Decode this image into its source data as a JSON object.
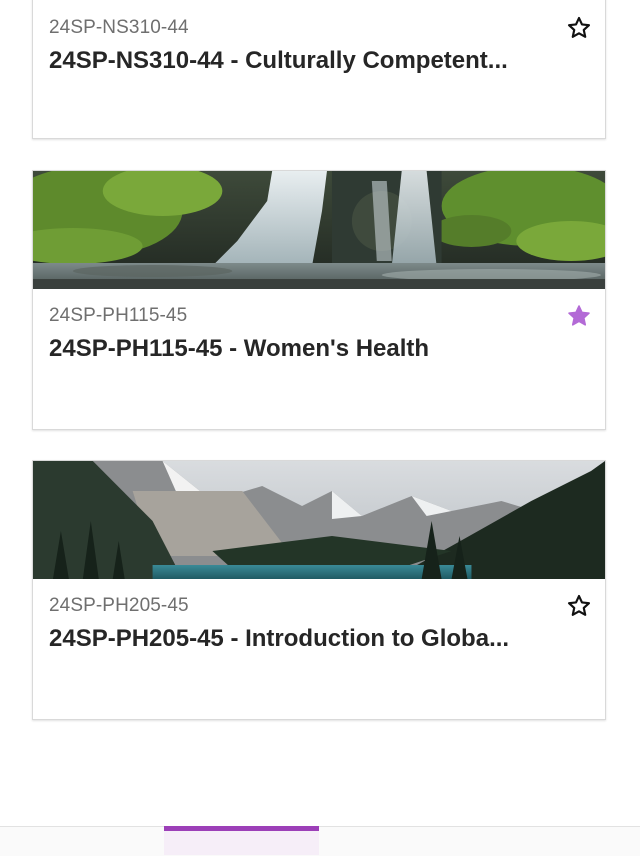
{
  "courses": [
    {
      "code": "24SP-NS310-44",
      "title": "24SP-NS310-44 - Culturally Competent...",
      "favorite": false,
      "banner": "none"
    },
    {
      "code": "24SP-PH115-45",
      "title": "24SP-PH115-45 - Women's Health",
      "favorite": true,
      "banner": "waterfall"
    },
    {
      "code": "24SP-PH205-45",
      "title": "24SP-PH205-45 - Introduction to Globa...",
      "favorite": false,
      "banner": "mountain-lake"
    }
  ],
  "icons": {
    "favorite_on": "star-filled-icon",
    "favorite_off": "star-outline-icon"
  },
  "colors": {
    "accent": "#9c3fb8",
    "favorite_star": "#b36ad6",
    "code_text": "#6f6f6f",
    "title_text": "#262626"
  }
}
